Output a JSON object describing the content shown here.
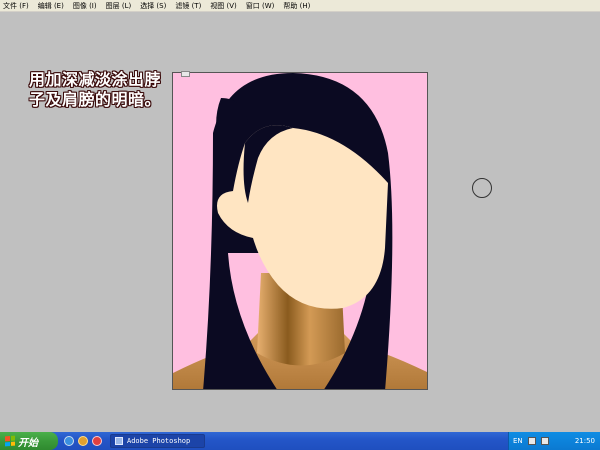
{
  "menubar": {
    "items": [
      "文件 (F)",
      "编辑 (E)",
      "图像 (I)",
      "图层 (L)",
      "选择 (S)",
      "滤镜 (T)",
      "视图 (V)",
      "窗口 (W)",
      "帮助 (H)"
    ]
  },
  "caption": {
    "line1": "用加深减淡涂出脖",
    "line2": "子及肩膀的明暗。"
  },
  "taskbar": {
    "start_label": "开始",
    "task_label": "Adobe Photoshop",
    "lang": "EN",
    "clock": "21:50"
  },
  "colors": {
    "workspace": "#c0c0c0",
    "canvas_bg": "#ffbfe0",
    "hair": "#0b0a22",
    "skin": "#ffe5c2",
    "neck_shadow": "#8a5b1e"
  }
}
